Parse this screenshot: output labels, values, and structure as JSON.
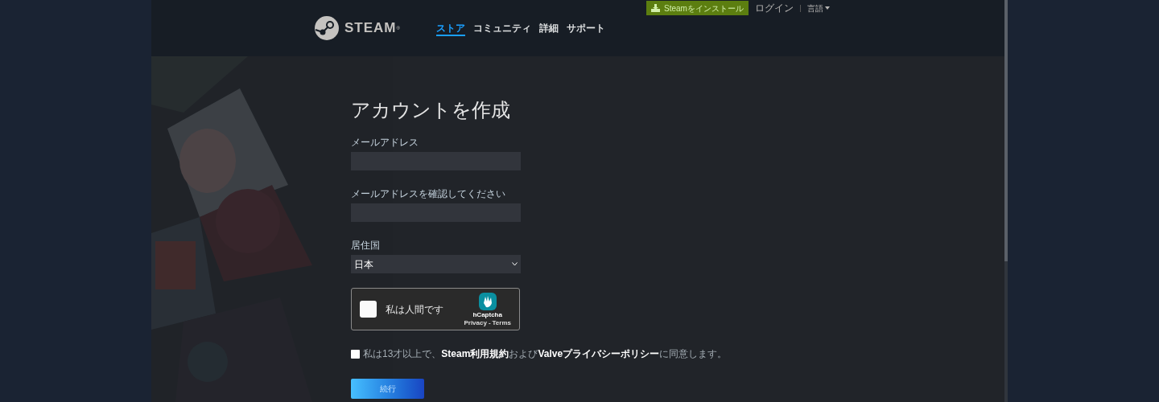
{
  "header": {
    "logo_text": "STEAM",
    "logo_mark": "®",
    "nav": [
      {
        "label": "ストア",
        "selected": true
      },
      {
        "label": "コミュニティ",
        "selected": false
      },
      {
        "label": "詳細",
        "selected": false
      },
      {
        "label": "サポート",
        "selected": false
      }
    ],
    "install_button": "Steamをインストール",
    "login_link": "ログイン",
    "language_menu": "言語"
  },
  "form": {
    "title": "アカウントを作成",
    "fields": [
      {
        "kind": "text",
        "label": "メールアドレス"
      },
      {
        "kind": "text",
        "label": "メールアドレスを確認してください"
      },
      {
        "kind": "select",
        "label": "居住国",
        "value": "日本"
      }
    ],
    "captcha": {
      "label": "私は人間です",
      "checked": false,
      "brand": "hCaptcha",
      "privacy": "Privacy",
      "separator": "-",
      "terms": "Terms"
    },
    "agreement": {
      "checked": false,
      "parts": [
        {
          "kind": "text",
          "text": "私は13才以上で、"
        },
        {
          "kind": "link",
          "text": "Steam利用規約"
        },
        {
          "kind": "text",
          "text": "および"
        },
        {
          "kind": "link",
          "text": "Valveプライバシーポリシー"
        },
        {
          "kind": "text",
          "text": "に同意します。"
        }
      ]
    },
    "submit": "続行"
  }
}
